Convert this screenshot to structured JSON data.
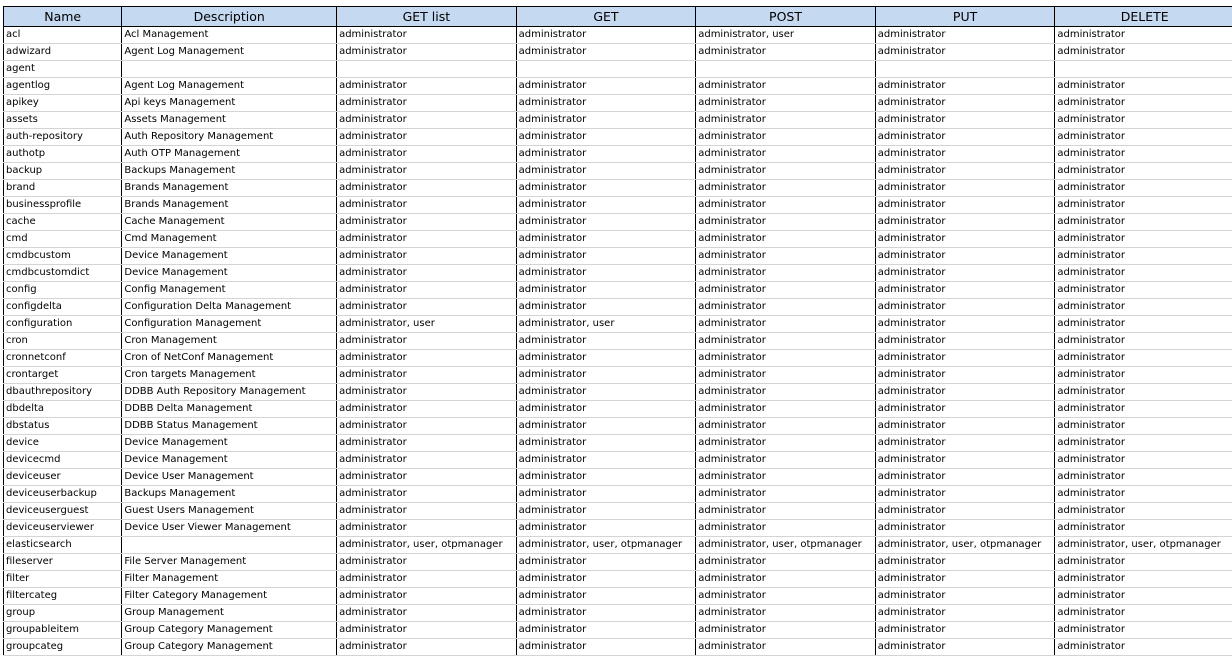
{
  "headers": [
    "Name",
    "Description",
    "GET list",
    "GET",
    "POST",
    "PUT",
    "DELETE"
  ],
  "rows": [
    [
      "acl",
      "Acl Management",
      "administrator",
      "administrator",
      "administrator, user",
      "administrator",
      "administrator"
    ],
    [
      "adwizard",
      "Agent Log Management",
      "administrator",
      "administrator",
      "administrator",
      "administrator",
      "administrator"
    ],
    [
      "agent",
      "",
      "",
      "",
      "",
      "",
      ""
    ],
    [
      "agentlog",
      "Agent Log Management",
      "administrator",
      "administrator",
      "administrator",
      "administrator",
      "administrator"
    ],
    [
      "apikey",
      "Api keys Management",
      "administrator",
      "administrator",
      "administrator",
      "administrator",
      "administrator"
    ],
    [
      "assets",
      "Assets Management",
      "administrator",
      "administrator",
      "administrator",
      "administrator",
      "administrator"
    ],
    [
      "auth-repository",
      "Auth Repository Management",
      "administrator",
      "administrator",
      "administrator",
      "administrator",
      "administrator"
    ],
    [
      "authotp",
      "Auth OTP Management",
      "administrator",
      "administrator",
      "administrator",
      "administrator",
      "administrator"
    ],
    [
      "backup",
      "Backups Management",
      "administrator",
      "administrator",
      "administrator",
      "administrator",
      "administrator"
    ],
    [
      "brand",
      "Brands Management",
      "administrator",
      "administrator",
      "administrator",
      "administrator",
      "administrator"
    ],
    [
      "businessprofile",
      "Brands Management",
      "administrator",
      "administrator",
      "administrator",
      "administrator",
      "administrator"
    ],
    [
      "cache",
      "Cache Management",
      "administrator",
      "administrator",
      "administrator",
      "administrator",
      "administrator"
    ],
    [
      "cmd",
      "Cmd Management",
      "administrator",
      "administrator",
      "administrator",
      "administrator",
      "administrator"
    ],
    [
      "cmdbcustom",
      "Device Management",
      "administrator",
      "administrator",
      "administrator",
      "administrator",
      "administrator"
    ],
    [
      "cmdbcustomdict",
      "Device Management",
      "administrator",
      "administrator",
      "administrator",
      "administrator",
      "administrator"
    ],
    [
      "config",
      "Config Management",
      "administrator",
      "administrator",
      "administrator",
      "administrator",
      "administrator"
    ],
    [
      "configdelta",
      "Configuration Delta Management",
      "administrator",
      "administrator",
      "administrator",
      "administrator",
      "administrator"
    ],
    [
      "configuration",
      "Configuration Management",
      "administrator, user",
      "administrator, user",
      "administrator",
      "administrator",
      "administrator"
    ],
    [
      "cron",
      "Cron Management",
      "administrator",
      "administrator",
      "administrator",
      "administrator",
      "administrator"
    ],
    [
      "cronnetconf",
      "Cron of NetConf Management",
      "administrator",
      "administrator",
      "administrator",
      "administrator",
      "administrator"
    ],
    [
      "crontarget",
      "Cron targets Management",
      "administrator",
      "administrator",
      "administrator",
      "administrator",
      "administrator"
    ],
    [
      "dbauthrepository",
      "DDBB Auth Repository Management",
      "administrator",
      "administrator",
      "administrator",
      "administrator",
      "administrator"
    ],
    [
      "dbdelta",
      "DDBB Delta Management",
      "administrator",
      "administrator",
      "administrator",
      "administrator",
      "administrator"
    ],
    [
      "dbstatus",
      "DDBB Status Management",
      "administrator",
      "administrator",
      "administrator",
      "administrator",
      "administrator"
    ],
    [
      "device",
      "Device Management",
      "administrator",
      "administrator",
      "administrator",
      "administrator",
      "administrator"
    ],
    [
      "devicecmd",
      "Device Management",
      "administrator",
      "administrator",
      "administrator",
      "administrator",
      "administrator"
    ],
    [
      "deviceuser",
      "Device User Management",
      "administrator",
      "administrator",
      "administrator",
      "administrator",
      "administrator"
    ],
    [
      "deviceuserbackup",
      "Backups Management",
      "administrator",
      "administrator",
      "administrator",
      "administrator",
      "administrator"
    ],
    [
      "deviceuserguest",
      "Guest Users Management",
      "administrator",
      "administrator",
      "administrator",
      "administrator",
      "administrator"
    ],
    [
      "deviceuserviewer",
      "Device User Viewer Management",
      "administrator",
      "administrator",
      "administrator",
      "administrator",
      "administrator"
    ],
    [
      "elasticsearch",
      "",
      "administrator, user, otpmanager",
      "administrator, user, otpmanager",
      "administrator, user, otpmanager",
      "administrator, user, otpmanager",
      "administrator, user, otpmanager"
    ],
    [
      "fileserver",
      "File Server Management",
      "administrator",
      "administrator",
      "administrator",
      "administrator",
      "administrator"
    ],
    [
      "filter",
      "Filter Management",
      "administrator",
      "administrator",
      "administrator",
      "administrator",
      "administrator"
    ],
    [
      "filtercateg",
      "Filter Category Management",
      "administrator",
      "administrator",
      "administrator",
      "administrator",
      "administrator"
    ],
    [
      "group",
      "Group Management",
      "administrator",
      "administrator",
      "administrator",
      "administrator",
      "administrator"
    ],
    [
      "groupableitem",
      "Group Category Management",
      "administrator",
      "administrator",
      "administrator",
      "administrator",
      "administrator"
    ],
    [
      "groupcateg",
      "Group Category Management",
      "administrator",
      "administrator",
      "administrator",
      "administrator",
      "administrator"
    ]
  ]
}
